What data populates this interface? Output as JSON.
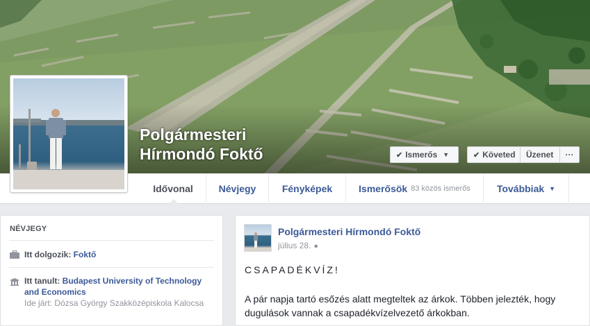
{
  "page": {
    "name_line1": "Polgármesteri",
    "name_line2": "Hírmondó Foktő"
  },
  "cover_buttons": {
    "friend": "Ismerős",
    "follow": "Követed",
    "message": "Üzenet",
    "more": "···"
  },
  "nav": {
    "timeline": "Idővonal",
    "about": "Névjegy",
    "photos": "Fényképek",
    "friends": "Ismerősök",
    "friends_sub": "83 közös ismerős",
    "more": "Továbbiak"
  },
  "about_card": {
    "header": "NÉVJEGY",
    "work_label": "Itt dolgozik:",
    "work_value": "Foktő",
    "study_label": "Itt tanult:",
    "study_value": "Budapest University of Technology and Economics",
    "attended_label": "Ide járt:",
    "attended_value": "Dózsa György Szakközépiskola Kalocsa"
  },
  "post": {
    "author": "Polgármesteri Hírmondó Foktő",
    "date": "július 28.",
    "title": "CSAPADÉKVÍZ!",
    "body": "A pár napja tartó esőzés alatt megteltek az árkok. Többen jelezték, hogy dugulások vannak a csapadékvízelvezető árkokban."
  },
  "colors": {
    "link": "#3b5998",
    "text": "#4b4f56",
    "muted": "#90949c",
    "background": "#e9eaed"
  },
  "icons": {
    "work": "briefcase-icon",
    "study": "graduation-cap-icon",
    "privacy": "globe-icon",
    "check": "checkmark-icon",
    "dropdown": "caret-down-icon"
  }
}
